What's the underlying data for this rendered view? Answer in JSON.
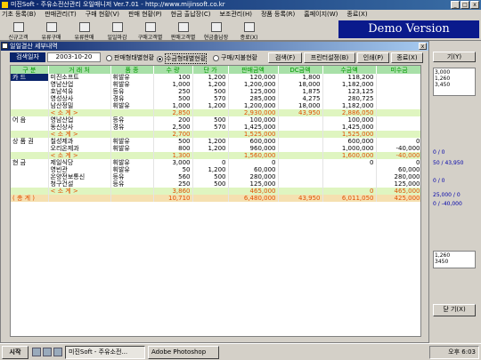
{
  "app": {
    "title": "미진Soft - 주유소전산관리 오일매니저 Ver.7.01 - http://www.mijinsoft.co.kr",
    "window_buttons": [
      "_",
      "□",
      "x"
    ]
  },
  "menu": [
    "기초 등록(B)",
    "판매관리(T)",
    "구매 현황(V)",
    "판매 현황(P)",
    "현금 출납장(C)",
    "보조관리(H)",
    "정품 등록(R)",
    "홈페이지(W)",
    "종료(X)"
  ],
  "toolbar": [
    "신규고객",
    "유류구매",
    "유류판매",
    "일일마감",
    "구매고객별",
    "판매고객별",
    "현금출납장",
    "종료(X)"
  ],
  "demo_label": "Demo Version",
  "right_panel": {
    "button_top": "기(Y)",
    "values_top": [
      "3,000",
      "1,260",
      "3,450"
    ],
    "indicators": [
      "0 / 0",
      "50 / 43,950",
      "0 / 0",
      "25,000 / 0",
      "0 / -40,000"
    ],
    "values_bottom": [
      "1,260",
      "3450"
    ],
    "button_bottom": "닫 기(X)"
  },
  "subwindow": {
    "title": "일일결산 세부내역",
    "close": "x",
    "date_label": "검색일자",
    "date_value": "2003-10-20",
    "radios": [
      {
        "label": "판매형태별현황",
        "selected": false
      },
      {
        "label": "수금형태별현황",
        "selected": true
      },
      {
        "label": "구매/지불현황",
        "selected": false
      }
    ],
    "buttons": [
      "검색(F)",
      "프린터설정(B)",
      "인쇄(P)",
      "종료(X)"
    ]
  },
  "table": {
    "headers": [
      "구 분",
      "거 래 처",
      "품 종",
      "수 량",
      "단 가",
      "판매금액",
      "DC금액",
      "수금액",
      "미수금"
    ],
    "rows": [
      {
        "kind": "first",
        "cells": [
          "카 드",
          "미진소프트",
          "휘발유",
          "100",
          "1,200",
          "120,000",
          "1,800",
          "118,200",
          ""
        ]
      },
      {
        "kind": "data",
        "cells": [
          "",
          "영남산업",
          "휘발유",
          "1,000",
          "1,200",
          "1,200,000",
          "18,000",
          "1,182,000",
          ""
        ]
      },
      {
        "kind": "data",
        "cells": [
          "",
          "호남석유",
          "등유",
          "250",
          "500",
          "125,000",
          "1,875",
          "123,125",
          ""
        ]
      },
      {
        "kind": "data",
        "cells": [
          "",
          "영성상사",
          "경유",
          "500",
          "570",
          "285,000",
          "4,275",
          "280,725",
          ""
        ]
      },
      {
        "kind": "data",
        "cells": [
          "",
          "남산정밀",
          "휘발유",
          "1,000",
          "1,200",
          "1,200,000",
          "18,000",
          "1,182,000",
          ""
        ]
      },
      {
        "kind": "sub",
        "cells": [
          "",
          "< 소 계 >",
          "",
          "2,850",
          "",
          "2,930,000",
          "43,950",
          "2,886,050",
          ""
        ]
      },
      {
        "kind": "data",
        "cells": [
          "어 음",
          "영남산업",
          "등유",
          "200",
          "500",
          "100,000",
          "",
          "100,000",
          ""
        ]
      },
      {
        "kind": "data",
        "cells": [
          "",
          "동신상사",
          "경유",
          "2,500",
          "570",
          "1,425,000",
          "",
          "1,425,000",
          ""
        ]
      },
      {
        "kind": "sub",
        "cells": [
          "",
          "< 소 계 >",
          "",
          "2,700",
          "",
          "1,525,000",
          "",
          "1,525,000",
          ""
        ]
      },
      {
        "kind": "data",
        "cells": [
          "상 품 권",
          "칠성제과",
          "휘발유",
          "500",
          "1,200",
          "600,000",
          "",
          "600,000",
          "0"
        ]
      },
      {
        "kind": "data",
        "cells": [
          "",
          "오리온제과",
          "휘발유",
          "800",
          "1,200",
          "960,000",
          "",
          "1,000,000",
          "-40,000"
        ]
      },
      {
        "kind": "sub",
        "cells": [
          "",
          "< 소 계 >",
          "",
          "1,300",
          "",
          "1,560,000",
          "",
          "1,600,000",
          "-40,000"
        ]
      },
      {
        "kind": "data",
        "cells": [
          "현 금",
          "제일식당",
          "휘발유",
          "3,000",
          "0",
          "0",
          "",
          "0",
          "0"
        ]
      },
      {
        "kind": "data",
        "cells": [
          "",
          "영빈관",
          "휘발유",
          "50",
          "1,200",
          "60,000",
          "",
          "",
          "60,000"
        ]
      },
      {
        "kind": "data",
        "cells": [
          "",
          "온양전보통신",
          "등유",
          "560",
          "500",
          "280,000",
          "",
          "",
          "280,000"
        ]
      },
      {
        "kind": "data",
        "cells": [
          "",
          "청구건설",
          "등유",
          "250",
          "500",
          "125,000",
          "",
          "",
          "125,000"
        ]
      },
      {
        "kind": "sub",
        "cells": [
          "",
          "< 소 계 >",
          "",
          "3,860",
          "",
          "465,000",
          "",
          "0",
          "465,000"
        ]
      },
      {
        "kind": "total",
        "cells": [
          "( 총 계 )",
          "",
          "",
          "10,710",
          "",
          "6,480,000",
          "43,950",
          "6,011,050",
          "425,000"
        ]
      }
    ]
  },
  "taskbar": {
    "start": "시작",
    "tasks": [
      "미진Soft - 주유소전...",
      "Adobe Photoshop"
    ],
    "clock": "오후 6:03"
  }
}
